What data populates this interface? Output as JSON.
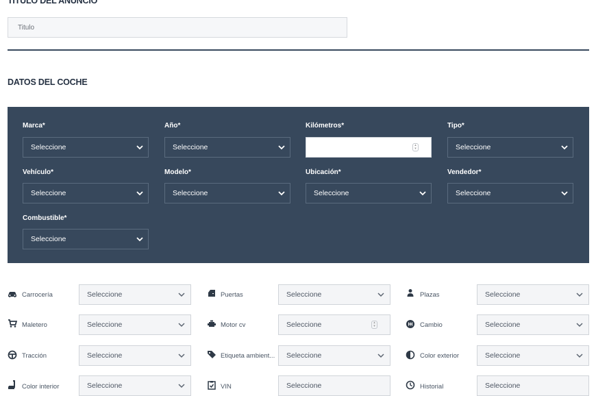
{
  "title_section": {
    "heading": "TÍTULO DEL ANUNCIO",
    "input_placeholder": "Titulo"
  },
  "car_section": {
    "heading": "DATOS DEL COCHE",
    "fields": [
      {
        "label": "Marca*",
        "value": "Seleccione"
      },
      {
        "label": "Año*",
        "value": "Seleccione"
      },
      {
        "label": "Kilómetros*",
        "value": ""
      },
      {
        "label": "Tipo*",
        "value": "Seleccione"
      },
      {
        "label": "Vehículo*",
        "value": "Seleccione"
      },
      {
        "label": "Modelo*",
        "value": "Seleccione"
      },
      {
        "label": "Ubicación*",
        "value": "Seleccione"
      },
      {
        "label": "Vendedor*",
        "value": "Seleccione"
      },
      {
        "label": "Combustible*",
        "value": "Seleccione"
      }
    ]
  },
  "optional_fields": [
    {
      "label": "Carrocería",
      "value": "Seleccione",
      "icon": "car-icon"
    },
    {
      "label": "Puertas",
      "value": "Seleccione",
      "icon": "door-icon"
    },
    {
      "label": "Plazas",
      "value": "Seleccione",
      "icon": "person-icon"
    },
    {
      "label": "Maletero",
      "value": "Seleccione",
      "icon": "cart-icon"
    },
    {
      "label": "Motor cv",
      "value": "Seleccione",
      "icon": "engine-icon"
    },
    {
      "label": "Cambio",
      "value": "Seleccione",
      "icon": "gearbox-icon"
    },
    {
      "label": "Tracción",
      "value": "Seleccione",
      "icon": "steering-wheel-icon"
    },
    {
      "label": "Etiqueta ambient...",
      "value": "Seleccione",
      "icon": "tag-icon"
    },
    {
      "label": "Color exterior",
      "value": "Seleccione",
      "icon": "half-circle-icon"
    },
    {
      "label": "Color interior",
      "value": "Seleccione",
      "icon": "seat-icon"
    },
    {
      "label": "VIN",
      "value": "Seleccione",
      "icon": "clipboard-check-icon"
    },
    {
      "label": "Historial",
      "value": "Seleccione",
      "icon": "clock-icon"
    }
  ],
  "colors": {
    "panel_bg": "#37485c",
    "heading": "#253142",
    "field_bg": "#f4f5f7"
  }
}
